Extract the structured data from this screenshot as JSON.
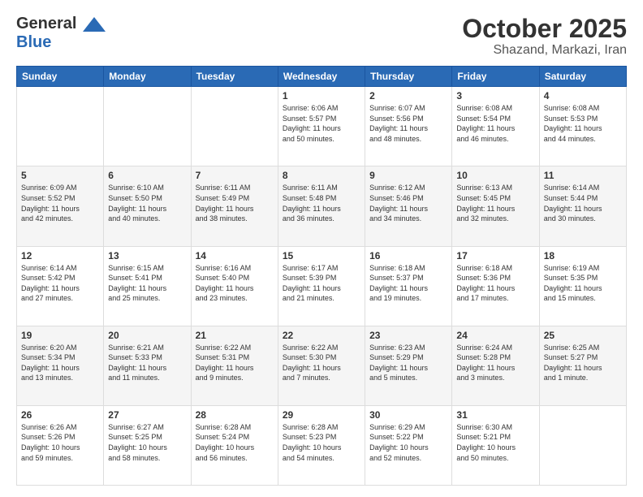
{
  "header": {
    "logo_general": "General",
    "logo_blue": "Blue",
    "month": "October 2025",
    "location": "Shazand, Markazi, Iran"
  },
  "weekdays": [
    "Sunday",
    "Monday",
    "Tuesday",
    "Wednesday",
    "Thursday",
    "Friday",
    "Saturday"
  ],
  "weeks": [
    [
      {
        "day": "",
        "info": ""
      },
      {
        "day": "",
        "info": ""
      },
      {
        "day": "",
        "info": ""
      },
      {
        "day": "1",
        "info": "Sunrise: 6:06 AM\nSunset: 5:57 PM\nDaylight: 11 hours\nand 50 minutes."
      },
      {
        "day": "2",
        "info": "Sunrise: 6:07 AM\nSunset: 5:56 PM\nDaylight: 11 hours\nand 48 minutes."
      },
      {
        "day": "3",
        "info": "Sunrise: 6:08 AM\nSunset: 5:54 PM\nDaylight: 11 hours\nand 46 minutes."
      },
      {
        "day": "4",
        "info": "Sunrise: 6:08 AM\nSunset: 5:53 PM\nDaylight: 11 hours\nand 44 minutes."
      }
    ],
    [
      {
        "day": "5",
        "info": "Sunrise: 6:09 AM\nSunset: 5:52 PM\nDaylight: 11 hours\nand 42 minutes."
      },
      {
        "day": "6",
        "info": "Sunrise: 6:10 AM\nSunset: 5:50 PM\nDaylight: 11 hours\nand 40 minutes."
      },
      {
        "day": "7",
        "info": "Sunrise: 6:11 AM\nSunset: 5:49 PM\nDaylight: 11 hours\nand 38 minutes."
      },
      {
        "day": "8",
        "info": "Sunrise: 6:11 AM\nSunset: 5:48 PM\nDaylight: 11 hours\nand 36 minutes."
      },
      {
        "day": "9",
        "info": "Sunrise: 6:12 AM\nSunset: 5:46 PM\nDaylight: 11 hours\nand 34 minutes."
      },
      {
        "day": "10",
        "info": "Sunrise: 6:13 AM\nSunset: 5:45 PM\nDaylight: 11 hours\nand 32 minutes."
      },
      {
        "day": "11",
        "info": "Sunrise: 6:14 AM\nSunset: 5:44 PM\nDaylight: 11 hours\nand 30 minutes."
      }
    ],
    [
      {
        "day": "12",
        "info": "Sunrise: 6:14 AM\nSunset: 5:42 PM\nDaylight: 11 hours\nand 27 minutes."
      },
      {
        "day": "13",
        "info": "Sunrise: 6:15 AM\nSunset: 5:41 PM\nDaylight: 11 hours\nand 25 minutes."
      },
      {
        "day": "14",
        "info": "Sunrise: 6:16 AM\nSunset: 5:40 PM\nDaylight: 11 hours\nand 23 minutes."
      },
      {
        "day": "15",
        "info": "Sunrise: 6:17 AM\nSunset: 5:39 PM\nDaylight: 11 hours\nand 21 minutes."
      },
      {
        "day": "16",
        "info": "Sunrise: 6:18 AM\nSunset: 5:37 PM\nDaylight: 11 hours\nand 19 minutes."
      },
      {
        "day": "17",
        "info": "Sunrise: 6:18 AM\nSunset: 5:36 PM\nDaylight: 11 hours\nand 17 minutes."
      },
      {
        "day": "18",
        "info": "Sunrise: 6:19 AM\nSunset: 5:35 PM\nDaylight: 11 hours\nand 15 minutes."
      }
    ],
    [
      {
        "day": "19",
        "info": "Sunrise: 6:20 AM\nSunset: 5:34 PM\nDaylight: 11 hours\nand 13 minutes."
      },
      {
        "day": "20",
        "info": "Sunrise: 6:21 AM\nSunset: 5:33 PM\nDaylight: 11 hours\nand 11 minutes."
      },
      {
        "day": "21",
        "info": "Sunrise: 6:22 AM\nSunset: 5:31 PM\nDaylight: 11 hours\nand 9 minutes."
      },
      {
        "day": "22",
        "info": "Sunrise: 6:22 AM\nSunset: 5:30 PM\nDaylight: 11 hours\nand 7 minutes."
      },
      {
        "day": "23",
        "info": "Sunrise: 6:23 AM\nSunset: 5:29 PM\nDaylight: 11 hours\nand 5 minutes."
      },
      {
        "day": "24",
        "info": "Sunrise: 6:24 AM\nSunset: 5:28 PM\nDaylight: 11 hours\nand 3 minutes."
      },
      {
        "day": "25",
        "info": "Sunrise: 6:25 AM\nSunset: 5:27 PM\nDaylight: 11 hours\nand 1 minute."
      }
    ],
    [
      {
        "day": "26",
        "info": "Sunrise: 6:26 AM\nSunset: 5:26 PM\nDaylight: 10 hours\nand 59 minutes."
      },
      {
        "day": "27",
        "info": "Sunrise: 6:27 AM\nSunset: 5:25 PM\nDaylight: 10 hours\nand 58 minutes."
      },
      {
        "day": "28",
        "info": "Sunrise: 6:28 AM\nSunset: 5:24 PM\nDaylight: 10 hours\nand 56 minutes."
      },
      {
        "day": "29",
        "info": "Sunrise: 6:28 AM\nSunset: 5:23 PM\nDaylight: 10 hours\nand 54 minutes."
      },
      {
        "day": "30",
        "info": "Sunrise: 6:29 AM\nSunset: 5:22 PM\nDaylight: 10 hours\nand 52 minutes."
      },
      {
        "day": "31",
        "info": "Sunrise: 6:30 AM\nSunset: 5:21 PM\nDaylight: 10 hours\nand 50 minutes."
      },
      {
        "day": "",
        "info": ""
      }
    ]
  ]
}
